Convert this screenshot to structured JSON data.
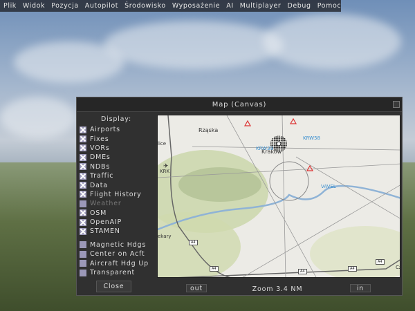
{
  "menu": [
    "Plik",
    "Widok",
    "Pozycja",
    "Autopilot",
    "Środowisko",
    "Wyposażenie",
    "AI",
    "Multiplayer",
    "Debug",
    "Pomoc"
  ],
  "dialog": {
    "title": "Map (Canvas)",
    "display_label": "Display:",
    "options": [
      {
        "label": "Airports",
        "checked": true
      },
      {
        "label": "Fixes",
        "checked": true
      },
      {
        "label": "VORs",
        "checked": true
      },
      {
        "label": "DMEs",
        "checked": true
      },
      {
        "label": "NDBs",
        "checked": true
      },
      {
        "label": "Traffic",
        "checked": true
      },
      {
        "label": "Data",
        "checked": true
      },
      {
        "label": "Flight History",
        "checked": true
      },
      {
        "label": "Weather",
        "checked": false,
        "disabled": true
      },
      {
        "label": "OSM",
        "checked": true
      },
      {
        "label": "OpenAIP",
        "checked": true
      },
      {
        "label": "STAMEN",
        "checked": true
      }
    ],
    "options2": [
      {
        "label": "Magnetic Hdgs",
        "checked": false
      },
      {
        "label": "Center on Acft",
        "checked": false
      },
      {
        "label": "Aircraft Hdg Up",
        "checked": false
      },
      {
        "label": "Transparent",
        "checked": false
      }
    ],
    "close": "Close",
    "out": "out",
    "in": "in",
    "zoom": "Zoom 3.4 NM",
    "map_labels": {
      "rzaska": "Rząska",
      "krakow": "Kraków",
      "krk": "KRK",
      "krw58": "KRW58",
      "krw39": "KRW39",
      "vavel": "VAVEL",
      "lice": "lice",
      "ekary": "ekary",
      "cz": "Cz",
      "a4": "A4"
    }
  }
}
